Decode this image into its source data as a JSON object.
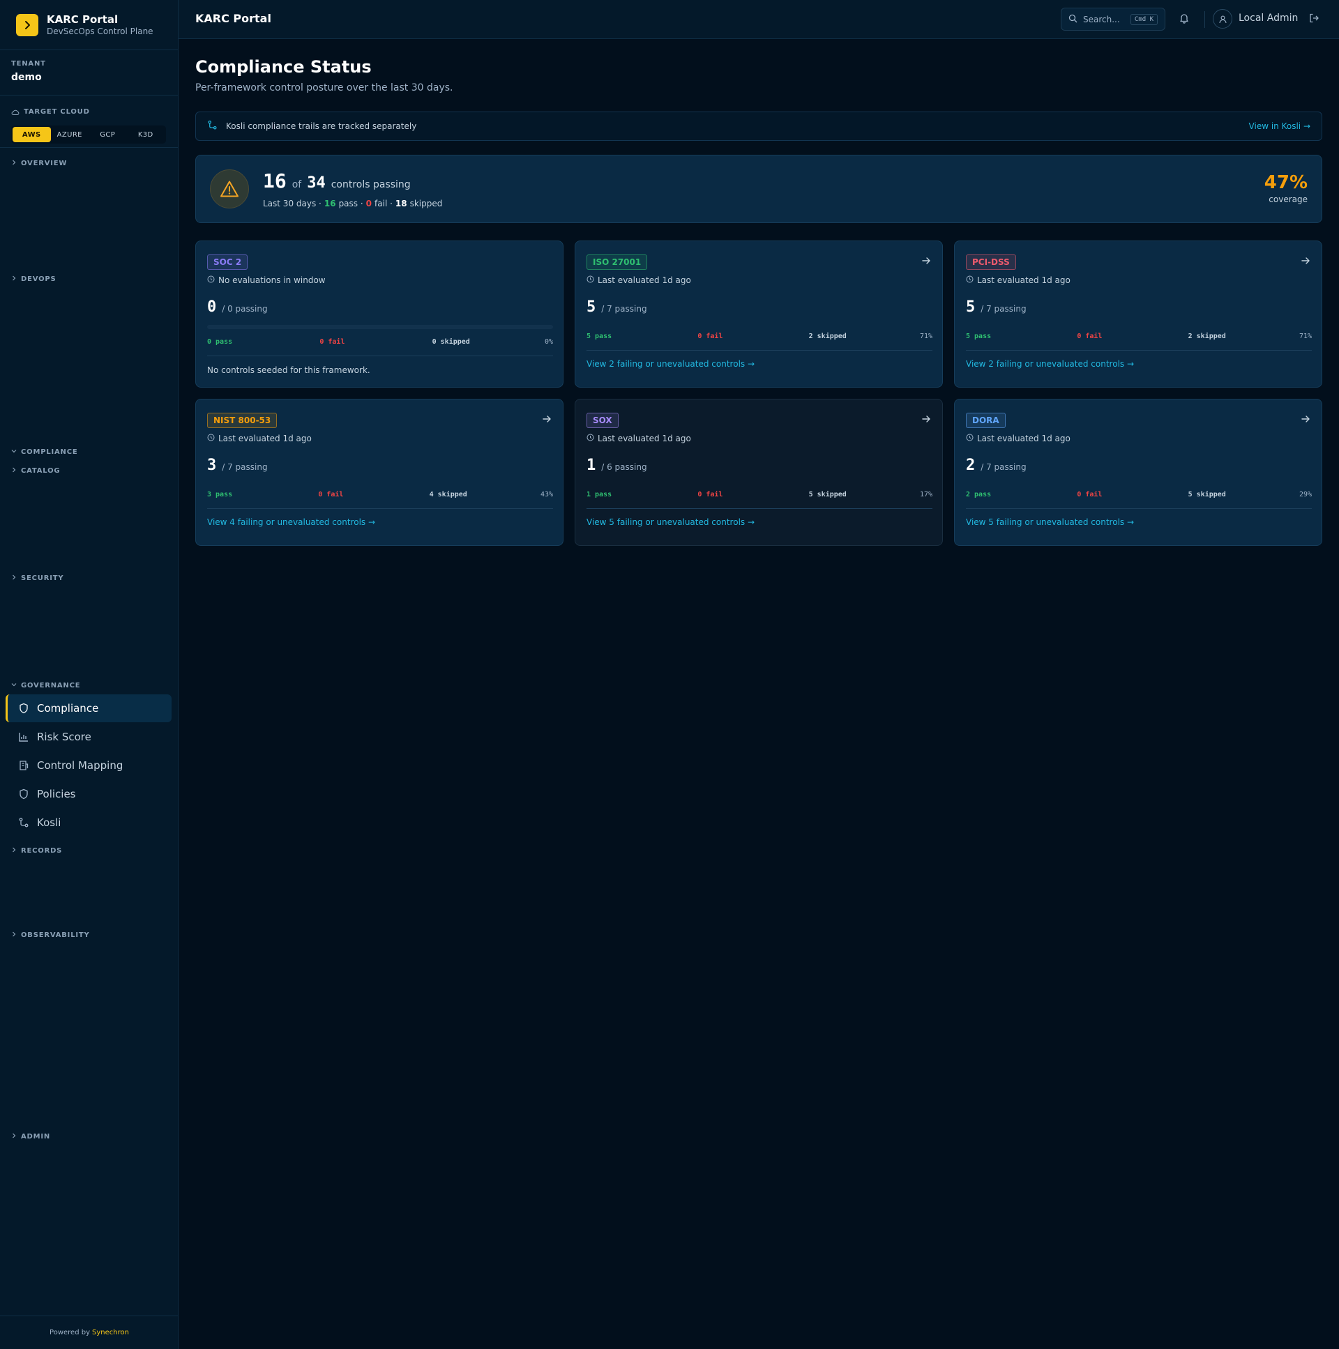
{
  "brand": {
    "title": "KARC Portal",
    "subtitle": "DevSecOps Control Plane"
  },
  "tenant": {
    "label": "TENANT",
    "name": "demo"
  },
  "target_cloud": {
    "label": "TARGET CLOUD",
    "options": [
      "AWS",
      "AZURE",
      "GCP",
      "K3D"
    ],
    "selected": "AWS"
  },
  "nav": {
    "overview": "OVERVIEW",
    "devops": "DEVOPS",
    "compliance": "COMPLIANCE",
    "catalog": "CATALOG",
    "security": "SECURITY",
    "governance": "GOVERNANCE",
    "governance_items": [
      "Compliance",
      "Risk Score",
      "Control Mapping",
      "Policies",
      "Kosli"
    ],
    "records": "RECORDS",
    "observability": "OBSERVABILITY",
    "admin": "ADMIN"
  },
  "footer": {
    "prefix": "Powered by",
    "company": "Synechron"
  },
  "topbar": {
    "title": "KARC Portal",
    "search_placeholder": "Search...",
    "search_shortcut": "Cmd K",
    "user": "Local Admin"
  },
  "page": {
    "title": "Compliance Status",
    "subtitle": "Per-framework control posture over the last 30 days."
  },
  "kosli_banner": {
    "text": "Kosli compliance trails are tracked separately",
    "link": "View in Kosli →"
  },
  "summary": {
    "passing": "16",
    "of_label": "of",
    "total": "34",
    "label": "controls passing",
    "window": "Last 30 days ·",
    "pass_count": "16",
    "pass_label": "pass ·",
    "fail_count": "0",
    "fail_label": "fail ·",
    "skipped_count": "18",
    "skipped_label": "skipped",
    "coverage_pct": "47%",
    "coverage_label": "coverage",
    "status_icon": "warning-triangle-icon",
    "accent_color": "#f59e0b"
  },
  "frameworks": [
    {
      "name": "SOC 2",
      "color": "#8b7cf6",
      "evaluated": "No evaluations in window",
      "passing": "0",
      "passing_label": "/ 0 passing",
      "pass": "0 pass",
      "fail": "0 fail",
      "skipped": "0 skipped",
      "pct": "0%",
      "progress": 0,
      "note": "No controls seeded for this framework."
    },
    {
      "name": "ISO 27001",
      "color": "#2fbf71",
      "evaluated": "Last evaluated 1d ago",
      "passing": "5",
      "passing_label": "/ 7 passing",
      "pass": "5 pass",
      "fail": "0 fail",
      "skipped": "2 skipped",
      "pct": "71%",
      "link": "View 2 failing or unevaluated controls →"
    },
    {
      "name": "PCI-DSS",
      "color": "#ef5b6e",
      "evaluated": "Last evaluated 1d ago",
      "passing": "5",
      "passing_label": "/ 7 passing",
      "pass": "5 pass",
      "fail": "0 fail",
      "skipped": "2 skipped",
      "pct": "71%",
      "link": "View 2 failing or unevaluated controls →"
    },
    {
      "name": "NIST 800-53",
      "color": "#f59e0b",
      "evaluated": "Last evaluated 1d ago",
      "passing": "3",
      "passing_label": "/ 7 passing",
      "pass": "3 pass",
      "fail": "0 fail",
      "skipped": "4 skipped",
      "pct": "43%",
      "link": "View 4 failing or unevaluated controls →"
    },
    {
      "name": "SOX",
      "color": "#a78bfa",
      "evaluated": "Last evaluated 1d ago",
      "passing": "1",
      "passing_label": "/ 6 passing",
      "pass": "1 pass",
      "fail": "0 fail",
      "skipped": "5 skipped",
      "pct": "17%",
      "link": "View 5 failing or unevaluated controls →"
    },
    {
      "name": "DORA",
      "color": "#60a5fa",
      "evaluated": "Last evaluated 1d ago",
      "passing": "2",
      "passing_label": "/ 7 passing",
      "pass": "2 pass",
      "fail": "0 fail",
      "skipped": "5 skipped",
      "pct": "29%",
      "link": "View 5 failing or unevaluated controls →"
    }
  ],
  "colors": {
    "accent": "#f5c518",
    "link": "#22b8e0",
    "pass": "#2fbf71",
    "fail": "#ef4444",
    "warning": "#f59e0b"
  }
}
